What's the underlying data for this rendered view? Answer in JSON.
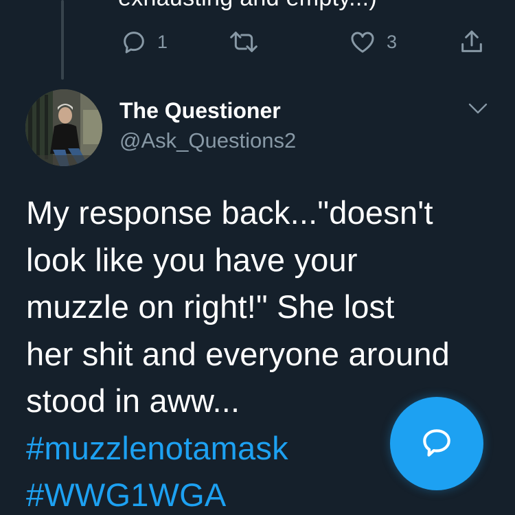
{
  "previous_tweet": {
    "text_fragment": "exhausting and empty...)",
    "reply_count": "1",
    "retweet_count": "",
    "like_count": "3"
  },
  "tweet": {
    "author_name": "The Questioner",
    "author_handle": "@Ask_Questions2",
    "text_lines": [
      "My response back...\"doesn't",
      "look like you have your",
      "muzzle on right!\"  She lost",
      "her shit and everyone around",
      "stood in aww..."
    ],
    "hashtags": [
      "#muzzlenotamask",
      "#WWG1WGA"
    ]
  },
  "icons": {
    "reply": "reply-icon",
    "retweet": "retweet-icon",
    "like": "heart-icon",
    "share": "share-icon",
    "more": "chevron-down-icon",
    "compose": "reply-bubble-icon"
  },
  "colors": {
    "background": "#15202b",
    "text_primary": "#ffffff",
    "text_secondary": "#8899a6",
    "accent": "#1da1f2",
    "thread_line": "#38444d"
  }
}
